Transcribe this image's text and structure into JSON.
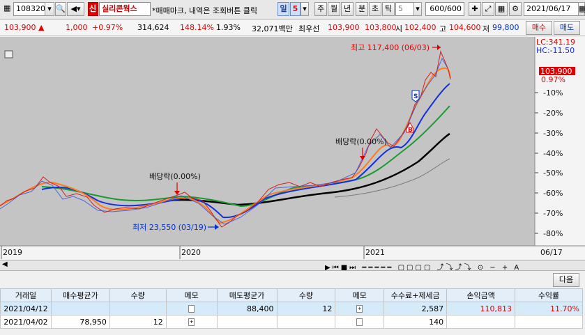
{
  "toolbar": {
    "code": "108320",
    "market_badge": "신",
    "stock_name": "실리콘웍스",
    "hint": "*매매마크, 내역은 조회버튼 클릭",
    "periods": [
      "일",
      "5",
      "주",
      "월",
      "년",
      "분",
      "초",
      "틱"
    ],
    "minute_value": "5",
    "count": "600/600",
    "date": "2021/06/17"
  },
  "quote": {
    "price": "103,900 ▲",
    "change": "1,000",
    "change_pct": "+0.97%",
    "volume": "314,624",
    "volume_ratio": "148.14%",
    "turnover": "1.93%",
    "amount": "32,071백만",
    "best_label": "최우선",
    "ask": "103,900",
    "bid": "103,800",
    "open_label": "시",
    "open": "102,400",
    "high_label": "고",
    "high": "104,600",
    "low_label": "저",
    "low": "99,800",
    "buy_button": "매수",
    "sell_button": "매도"
  },
  "chart": {
    "max_annot": "최고 117,400 (06/03)",
    "min_annot": "최저 23,550 (03/19)",
    "div1": "배당락(0.00%)",
    "div2": "배당락(0.00%)",
    "mark_s": "S",
    "mark_b": "B",
    "lc": "LC:341.19",
    "hc": "HC:-11.50",
    "price_tag": "103,900",
    "pct_tag": "0.97%",
    "axis": [
      "-10%",
      "-20%",
      "-30%",
      "-40%",
      "-50%",
      "-60%",
      "-70%",
      "-80%"
    ],
    "x_labels": [
      "2019",
      "2020",
      "2021",
      "06/17"
    ]
  },
  "next_button": "다음",
  "table": {
    "headers": [
      "거래일",
      "매수평균가",
      "수량",
      "메모",
      "매도평균가",
      "수량",
      "메모",
      "수수료+제세금",
      "손익금액",
      "수익률"
    ],
    "rows": [
      [
        "2021/04/12",
        "",
        "",
        "",
        "88,400",
        "12",
        "",
        "2,587",
        "110,813",
        "11.70%"
      ],
      [
        "2021/04/02",
        "78,950",
        "12",
        "",
        "",
        "",
        "",
        "140",
        "",
        ""
      ]
    ]
  },
  "colors": {
    "up": "#e00000",
    "down": "#0030d0",
    "ma5": "#ff7b1c",
    "ma20": "#1030e0",
    "ma60": "#1a9a30",
    "ma120": "#000000"
  }
}
